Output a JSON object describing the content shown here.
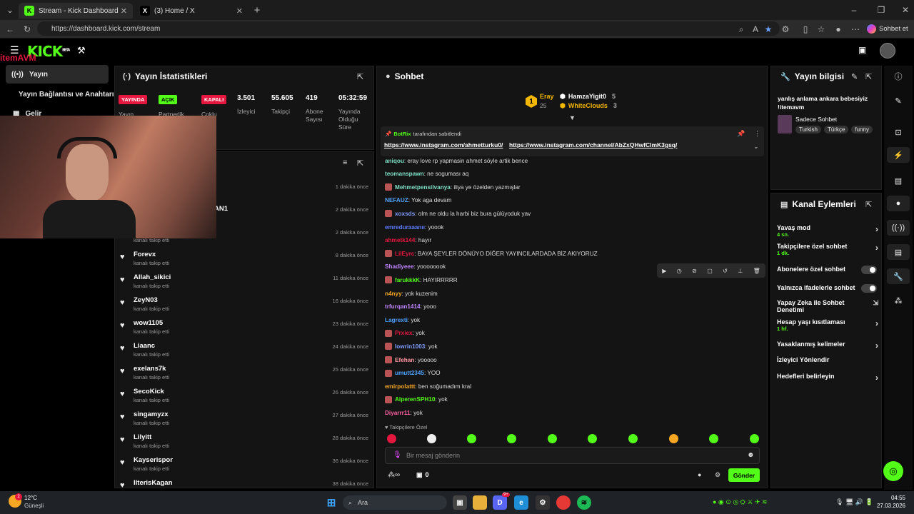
{
  "browser": {
    "tabs": [
      {
        "label": "Stream - Kick Dashboard",
        "icon": "kick-icon"
      },
      {
        "label": "(3) Home / X",
        "icon": "x-icon"
      }
    ],
    "url": "https://dashboard.kick.com/stream",
    "profile_label": "Sohbet et"
  },
  "left_nav": {
    "overlay_brand": "itemAVM",
    "items": [
      {
        "label": "Yayın"
      },
      {
        "label": "Yayın Bağlantısı ve Anahtarı"
      },
      {
        "label": "Gelir"
      }
    ]
  },
  "stats_panel": {
    "title": "Yayın İstatistikleri",
    "badges": [
      {
        "text": "YAYINDA",
        "label": "Yayın",
        "color": "#e5173f"
      },
      {
        "text": "AÇIK",
        "label": "Partnerlik",
        "color": "#53fc18"
      },
      {
        "text": "KAPALI",
        "label": "Çoklu",
        "color": "#e5173f"
      }
    ],
    "stats": [
      {
        "value": "3.501",
        "label": "İzleyici"
      },
      {
        "value": "55.605",
        "label": "Takipçi"
      },
      {
        "value": "419",
        "label": "Abone Sayısı"
      },
      {
        "value": "05:32:59",
        "label": "Yayında Olduğu Süre"
      }
    ]
  },
  "activity": {
    "partial_rows": [
      {
        "time": "1 dakika önce"
      },
      {
        "name_fragment": "AN1",
        "time": "2 dakika önce"
      },
      {
        "sub": "kanalı takip etti",
        "time": "2 dakika önce"
      }
    ],
    "rows": [
      {
        "name": "Forevx",
        "sub": "kanalı takip etti",
        "time": "8 dakika önce"
      },
      {
        "name": "Allah_sikici",
        "sub": "kanalı takip etti",
        "time": "11 dakika önce"
      },
      {
        "name": "ZeyN03",
        "sub": "kanalı takip etti",
        "time": "16 dakika önce"
      },
      {
        "name": "wow1105",
        "sub": "kanalı takip etti",
        "time": "23 dakika önce"
      },
      {
        "name": "Liaanc",
        "sub": "kanalı takip etti",
        "time": "24 dakika önce"
      },
      {
        "name": "exelans7k",
        "sub": "kanalı takip etti",
        "time": "25 dakika önce"
      },
      {
        "name": "SecoKick",
        "sub": "kanalı takip etti",
        "time": "26 dakika önce"
      },
      {
        "name": "singamyzx",
        "sub": "kanalı takip etti",
        "time": "27 dakika önce"
      },
      {
        "name": "Lilyitt",
        "sub": "kanalı takip etti",
        "time": "28 dakika önce"
      },
      {
        "name": "Kayserispor",
        "sub": "kanalı takip etti",
        "time": "36 dakika önce"
      },
      {
        "name": "IlterisKagan",
        "sub": "",
        "time": "38 dakika önce"
      }
    ]
  },
  "chat": {
    "title": "Sohbet",
    "leaderboard": [
      {
        "name": "Eray",
        "count": "25",
        "color": "#f5b800"
      },
      {
        "name": "HamzaYigit0",
        "count": "5",
        "color": "#fff"
      },
      {
        "name": "WhiteClouds",
        "count": "3",
        "color": "#f5b800"
      }
    ],
    "rank_number": "1",
    "pinned": {
      "author": "BotRix",
      "suffix": "tarafından sabitlendi",
      "link1": "https://www.instagram.com/ahmetturku0/",
      "link2": "https://www.instagram.com/channel/AbZxQHwfClmK3gsq/"
    },
    "messages": [
      {
        "user": "aniqou",
        "text": ": eray love rp yapmasin ahmet söyle artik bence",
        "color": "#7ee0c5",
        "badge": false
      },
      {
        "user": "teomanspawn",
        "text": ": ne soguması aq",
        "color": "#7ee0c5",
        "badge": false
      },
      {
        "user": "Mehmetpensilvanya",
        "text": ": iliya ye özelden yazmışlar",
        "color": "#7ee0c5",
        "badge": true
      },
      {
        "user": "NEFAUZ",
        "text": ": Yok aga devam",
        "color": "#4fa3ff",
        "badge": false
      },
      {
        "user": "xoxsds",
        "text": ": olm ne oldu la harbi biz bura gülüyoduk yav",
        "color": "#7e9cff",
        "badge": true
      },
      {
        "user": "emreduraaanıı",
        "text": ": yoook",
        "color": "#5b7cff",
        "badge": false
      },
      {
        "user": "ahmetk144",
        "text": ": hayır",
        "color": "#e5173f",
        "badge": false
      },
      {
        "user": "LilEyrc",
        "text": ": BAYA ŞEYLER DÖNÜYO DİĞER YAYINCILARDADA BİZ AKIYORUZ",
        "color": "#e5173f",
        "badge": true
      },
      {
        "user": "Shadiyeee",
        "text": ": yoooooook",
        "color": "#c086ff",
        "badge": false
      },
      {
        "user": "farukkkK",
        "text": ": HAYIRRRRR",
        "color": "#53fc18",
        "badge": true
      },
      {
        "user": "n4nyy",
        "text": ": yok kuzenim",
        "color": "#f5a623",
        "badge": false
      },
      {
        "user": "trfurqan1414",
        "text": ": yooo",
        "color": "#c086ff",
        "badge": false
      },
      {
        "user": "Lagrexti",
        "text": ": yok",
        "color": "#4fa3ff",
        "badge": false
      },
      {
        "user": "Prxiex",
        "text": ": yok",
        "color": "#e5173f",
        "badge": true
      },
      {
        "user": "lowrin1003",
        "text": ": yok",
        "color": "#7e9cff",
        "badge": true
      },
      {
        "user": "Efehan",
        "text": ": yooooo",
        "color": "#ff9aa2",
        "badge": true
      },
      {
        "user": "umutt2345",
        "text": ": YOO",
        "color": "#4fa3ff",
        "badge": true
      },
      {
        "user": "emirpolattt",
        "text": ": ben soğumadım kral",
        "color": "#f5a623",
        "badge": false
      },
      {
        "user": "AlperenSPH10",
        "text": ": yok",
        "color": "#53fc18",
        "badge": true
      },
      {
        "user": "Diyarrr11",
        "text": ": yok",
        "color": "#ff5fa2",
        "badge": false
      }
    ],
    "followers_only": "Takipçilere Özel",
    "input_placeholder": "Bir mesaj gönderin",
    "points": "0",
    "send_label": "Gönder"
  },
  "stream_info": {
    "title": "Yayın bilgisi",
    "stream_title": "yanlış anlama ankara bebesiyiz !itemavm",
    "category": "Sadece Sohbet",
    "tags": [
      "Turkish",
      "Türkçe",
      "funny"
    ]
  },
  "channel_actions": {
    "title": "Kanal Eylemleri",
    "items": [
      {
        "label": "Yavaş mod",
        "sub": "4 sn.",
        "control": "chevron"
      },
      {
        "label": "Takipçilere özel sohbet",
        "sub": "1 dk.",
        "control": "chevron"
      },
      {
        "label": "Abonelere özel sohbet",
        "sub": "",
        "control": "toggle"
      },
      {
        "label": "Yalnızca ifadelerle sohbet",
        "sub": "",
        "control": "toggle"
      },
      {
        "label": "Yapay Zeka ile Sohbet Denetimi",
        "sub": "",
        "control": "external"
      },
      {
        "label": "Hesap yaşı kısıtlaması",
        "sub": "1 hf.",
        "control": "chevron"
      },
      {
        "label": "Yasaklanmış kelimeler",
        "sub": "",
        "control": "chevron"
      },
      {
        "label": "İzleyici Yönlendir",
        "sub": "",
        "control": "none"
      },
      {
        "label": "Hedefleri belirleyin",
        "sub": "",
        "control": "chevron"
      }
    ]
  },
  "taskbar": {
    "weather_temp": "12°C",
    "weather_desc": "Güneşli",
    "weather_alert_count": "2",
    "search_placeholder": "Ara",
    "time": "04:55",
    "date": "27.03.2026",
    "discord_count": "9+"
  }
}
